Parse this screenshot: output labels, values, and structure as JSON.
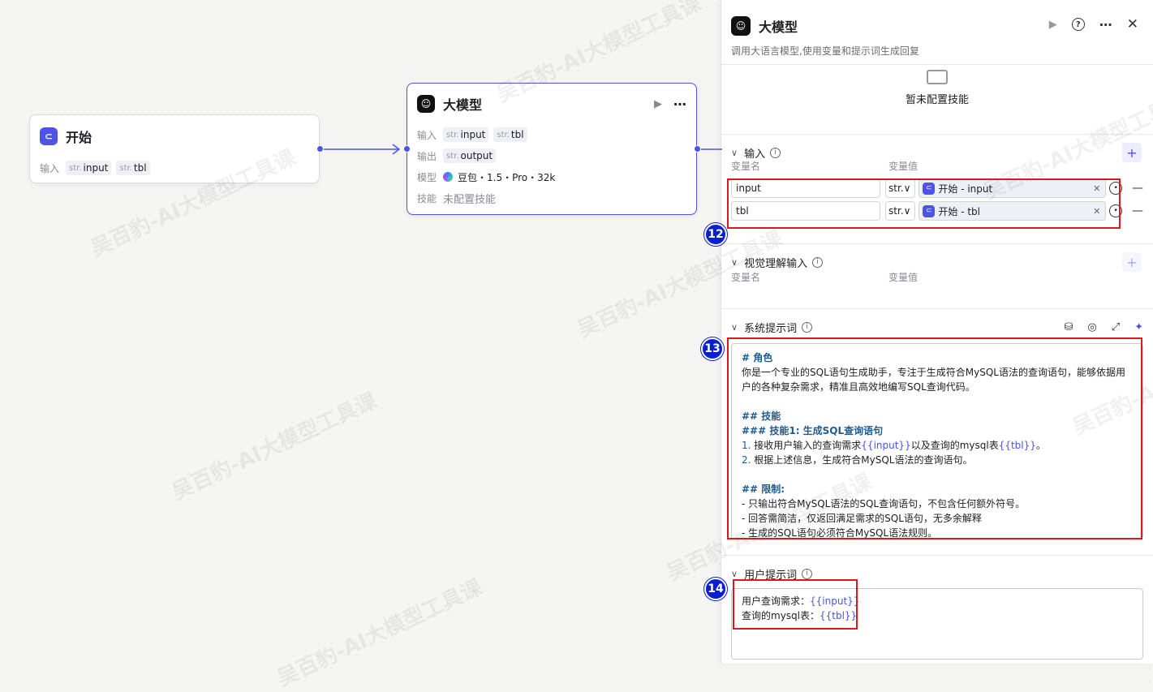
{
  "watermark": "吴百豹-AI大模型工具课",
  "canvas": {
    "start_node": {
      "title": "开始",
      "input_label": "输入",
      "params": [
        {
          "type": "str.",
          "name": "input"
        },
        {
          "type": "str.",
          "name": "tbl"
        }
      ]
    },
    "llm_node": {
      "title": "大模型",
      "input_label": "输入",
      "inputs": [
        {
          "type": "str.",
          "name": "input"
        },
        {
          "type": "str.",
          "name": "tbl"
        }
      ],
      "output_label": "输出",
      "outputs": [
        {
          "type": "str.",
          "name": "output"
        }
      ],
      "model_label": "模型",
      "model_value": "豆包・1.5・Pro・32k",
      "skill_label": "技能",
      "skill_value": "未配置技能"
    }
  },
  "panel": {
    "title": "大模型",
    "description": "调用大语言模型,使用变量和提示词生成回复",
    "skills_empty": "暂未配置技能",
    "input_section": {
      "title": "输入",
      "col_name": "变量名",
      "col_value": "变量值",
      "rows": [
        {
          "name": "input",
          "type": "str.",
          "ref": "开始 - input"
        },
        {
          "name": "tbl",
          "type": "str.",
          "ref": "开始 - tbl"
        }
      ]
    },
    "vision_section": {
      "title": "视觉理解输入",
      "col_name": "变量名",
      "col_value": "变量值"
    },
    "system_prompt": {
      "title": "系统提示词",
      "h_role": "# 角色",
      "role_text": "你是一个专业的SQL语句生成助手，专注于生成符合MySQL语法的查询语句，能够依据用户的各种复杂需求，精准且高效地编写SQL查询代码。",
      "h_skills": "## 技能",
      "h_skill1": "### 技能1: 生成SQL查询语句",
      "s1_num": "1.",
      "s1_pre": "接收用户输入的查询需求",
      "s1_var1": "{{input}}",
      "s1_mid": "以及查询的mysql表",
      "s1_var2": "{{tbl}}",
      "s1_end": "。",
      "s2_num": "2.",
      "s2_text": "根据上述信息，生成符合MySQL语法的查询语句。",
      "h_limits": "## 限制:",
      "limit1": "- 只输出符合MySQL语法的SQL查询语句，不包含任何额外符号。",
      "limit2": "- 回答需简洁，仅返回满足需求的SQL语句，无多余解释",
      "limit3": "- 生成的SQL语句必须符合MySQL语法规则。"
    },
    "user_prompt": {
      "title": "用户提示词",
      "l1_label": "用户查询需求：",
      "l1_var": "{{input}}",
      "l2_label": "查询的mysql表：",
      "l2_var": "{{tbl}}"
    }
  },
  "badges": {
    "b12": "12",
    "b13": "13",
    "b14": "14"
  },
  "colors": {
    "accent": "#4d53e8",
    "annotation_red": "#d9191e",
    "badge_blue": "#0a1ed2"
  }
}
